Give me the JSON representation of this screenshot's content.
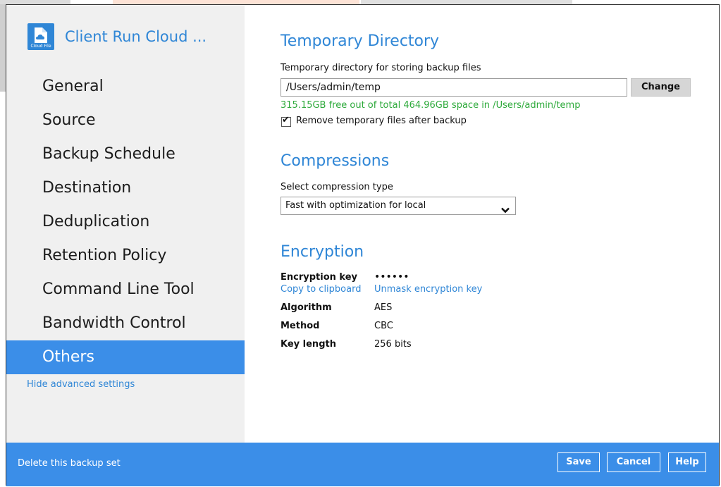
{
  "app": {
    "title": "Client Run Cloud ...",
    "logo_text": "Cloud File"
  },
  "nav": {
    "items": [
      {
        "label": "General"
      },
      {
        "label": "Source"
      },
      {
        "label": "Backup Schedule"
      },
      {
        "label": "Destination"
      },
      {
        "label": "Deduplication"
      },
      {
        "label": "Retention Policy"
      },
      {
        "label": "Command Line Tool"
      },
      {
        "label": "Bandwidth Control"
      },
      {
        "label": "Others"
      }
    ],
    "active": "Others",
    "hide_advanced": "Hide advanced settings"
  },
  "temp_dir": {
    "title": "Temporary Directory",
    "field_label": "Temporary directory for storing backup files",
    "path_value": "/Users/admin/temp",
    "change_label": "Change",
    "free_space": "315.15GB free out of total 464.96GB space in /Users/admin/temp",
    "remove_checkbox_label": "Remove temporary files after backup",
    "remove_checked": true
  },
  "compression": {
    "title": "Compressions",
    "field_label": "Select compression type",
    "selected": "Fast with optimization for local"
  },
  "encryption": {
    "title": "Encryption",
    "key_label": "Encryption key",
    "key_value": "••••••",
    "copy_link": "Copy to clipboard",
    "unmask_link": "Unmask encryption key",
    "algorithm_label": "Algorithm",
    "algorithm_value": "AES",
    "method_label": "Method",
    "method_value": "CBC",
    "key_length_label": "Key length",
    "key_length_value": "256 bits"
  },
  "footer": {
    "delete_link": "Delete this backup set",
    "save_label": "Save",
    "cancel_label": "Cancel",
    "help_label": "Help"
  },
  "colors": {
    "accent": "#3b8ee8",
    "link": "#2f86d6",
    "success": "#2eaa3b",
    "sidebar_bg": "#f0f0f0"
  }
}
